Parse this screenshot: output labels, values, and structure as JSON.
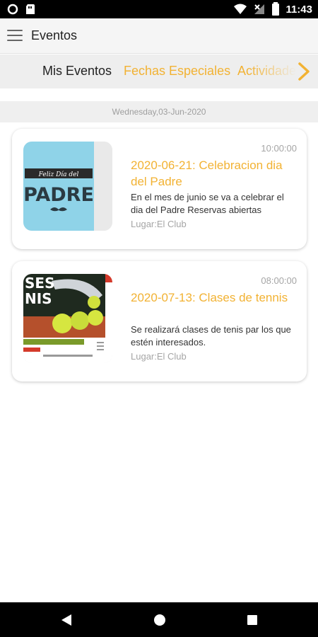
{
  "status_bar": {
    "time": "11:43"
  },
  "app_bar": {
    "title": "Eventos"
  },
  "tabs": [
    {
      "label": "Mis Eventos",
      "active": true
    },
    {
      "label": "Fechas Especiales",
      "active": false
    },
    {
      "label": "Actividades",
      "active": false
    }
  ],
  "date_header": "Wednesday,03-Jun-2020",
  "events": [
    {
      "time": "10:00:00",
      "title": "2020-06-21: Celebracion dia del Padre",
      "description": "En el mes de junio se va a celebrar el dia del Padre Reservas abiertas",
      "place": "Lugar:El Club",
      "image": {
        "banner": "Feliz Día del",
        "main": "PADRE"
      }
    },
    {
      "time": "08:00:00",
      "title": "2020-07-13: Clases de tennis",
      "description": "Se realizará clases de tenis par los que estén interesados.",
      "place": "Lugar:El Club",
      "image": {
        "top": "SES",
        "mid": "NIS"
      }
    }
  ],
  "colors": {
    "accent": "#f2b233",
    "thumb_bg_1": "#8fd3e8"
  }
}
